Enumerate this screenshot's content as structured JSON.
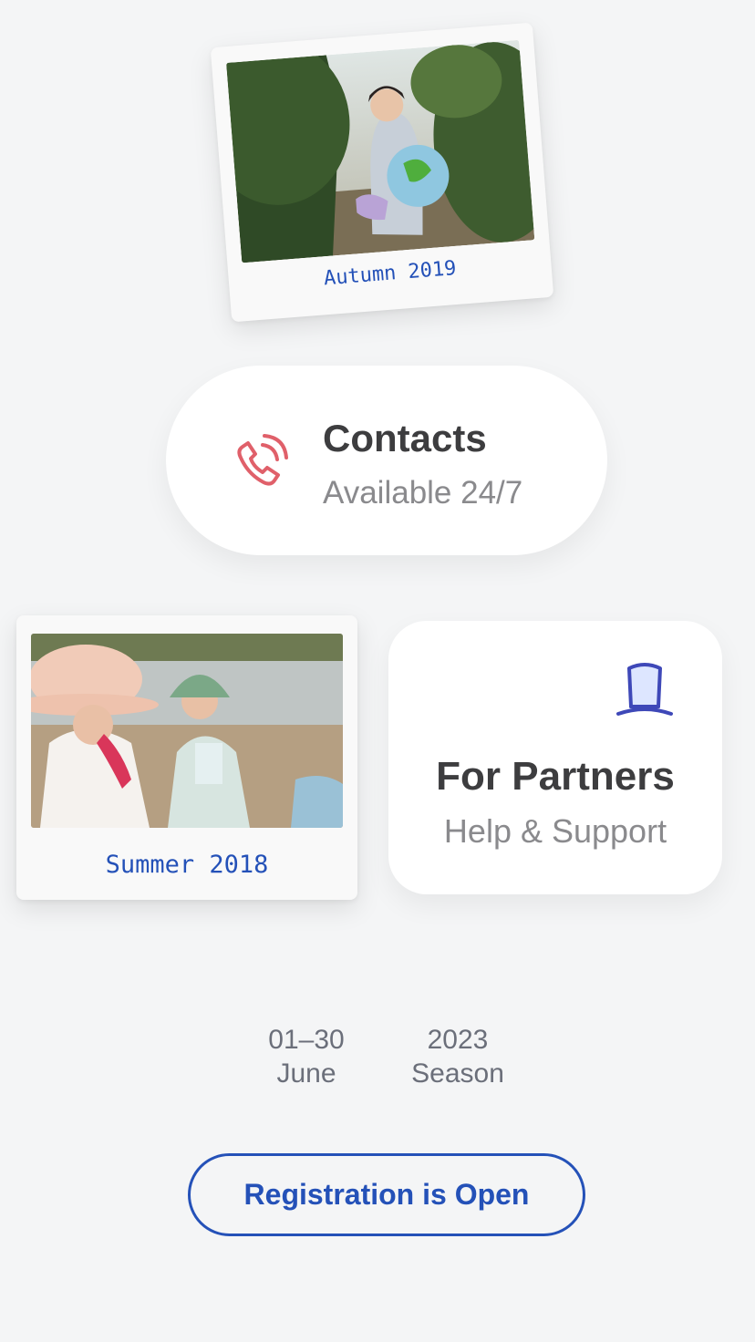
{
  "cards": {
    "autumn": {
      "caption": "Autumn 2019"
    },
    "summer": {
      "caption": "Summer 2018"
    }
  },
  "contacts": {
    "title": "Contacts",
    "subtitle": "Available 24/7",
    "icon": "phone-ringing-icon",
    "icon_color": "#e0606a"
  },
  "partners": {
    "title": "For Partners",
    "subtitle": "Help & Support",
    "icon": "top-hat-icon",
    "icon_color": "#3e48b8"
  },
  "stats": [
    {
      "line1": "01–30",
      "line2": "June"
    },
    {
      "line1": "2023",
      "line2": "Season"
    }
  ],
  "cta": {
    "label": "Registration is Open"
  },
  "colors": {
    "background": "#f4f5f6",
    "accent": "#2451b8",
    "text_dark": "#3d3d3f",
    "text_muted": "#8a8a8d"
  }
}
